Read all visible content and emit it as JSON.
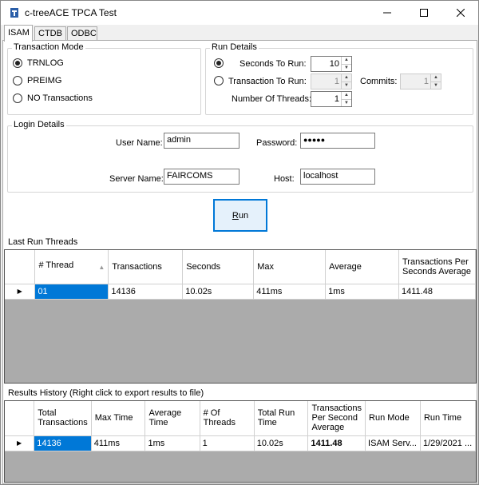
{
  "window": {
    "title": "c-treeACE TPCA Test"
  },
  "tabs": [
    {
      "label": "ISAM"
    },
    {
      "label": "CTDB"
    },
    {
      "label": "ODBC"
    }
  ],
  "transaction_mode": {
    "title": "Transaction Mode",
    "options": [
      {
        "label": "TRNLOG",
        "selected": true
      },
      {
        "label": "PREIMG",
        "selected": false
      },
      {
        "label": "NO Transactions",
        "selected": false
      }
    ]
  },
  "run_details": {
    "title": "Run Details",
    "seconds_label": "Seconds To Run:",
    "seconds_value": "10",
    "transaction_label": "Transaction To Run:",
    "transaction_value": "1",
    "commits_label": "Commits:",
    "commits_value": "1",
    "threads_label": "Number Of Threads:",
    "threads_value": "1"
  },
  "login": {
    "title": "Login Details",
    "user_label": "User Name:",
    "user_value": "admin",
    "password_label": "Password:",
    "password_value": "●●●●●",
    "server_label": "Server Name:",
    "server_value": "FAIRCOMS",
    "host_label": "Host:",
    "host_value": "localhost"
  },
  "run_button": {
    "label_underlined": "R",
    "label_rest": "un"
  },
  "last_run": {
    "title": "Last Run Threads",
    "columns": [
      "# Thread",
      "Transactions",
      "Seconds",
      "Max",
      "Average",
      "Transactions Per Seconds Average"
    ],
    "rows": [
      [
        "01",
        "14136",
        "10.02s",
        "411ms",
        "1ms",
        "1411.48"
      ]
    ]
  },
  "history": {
    "title": "Results History (Right click to export results to file)",
    "columns": [
      "Total Transactions",
      "Max Time",
      "Average Time",
      "# Of Threads",
      "Total Run Time",
      "Transactions Per Second Average",
      "Run Mode",
      "Run Time"
    ],
    "rows": [
      [
        "14136",
        "411ms",
        "1ms",
        "1",
        "10.02s",
        "1411.48",
        "ISAM Serv...",
        "1/29/2021 ..."
      ]
    ]
  }
}
